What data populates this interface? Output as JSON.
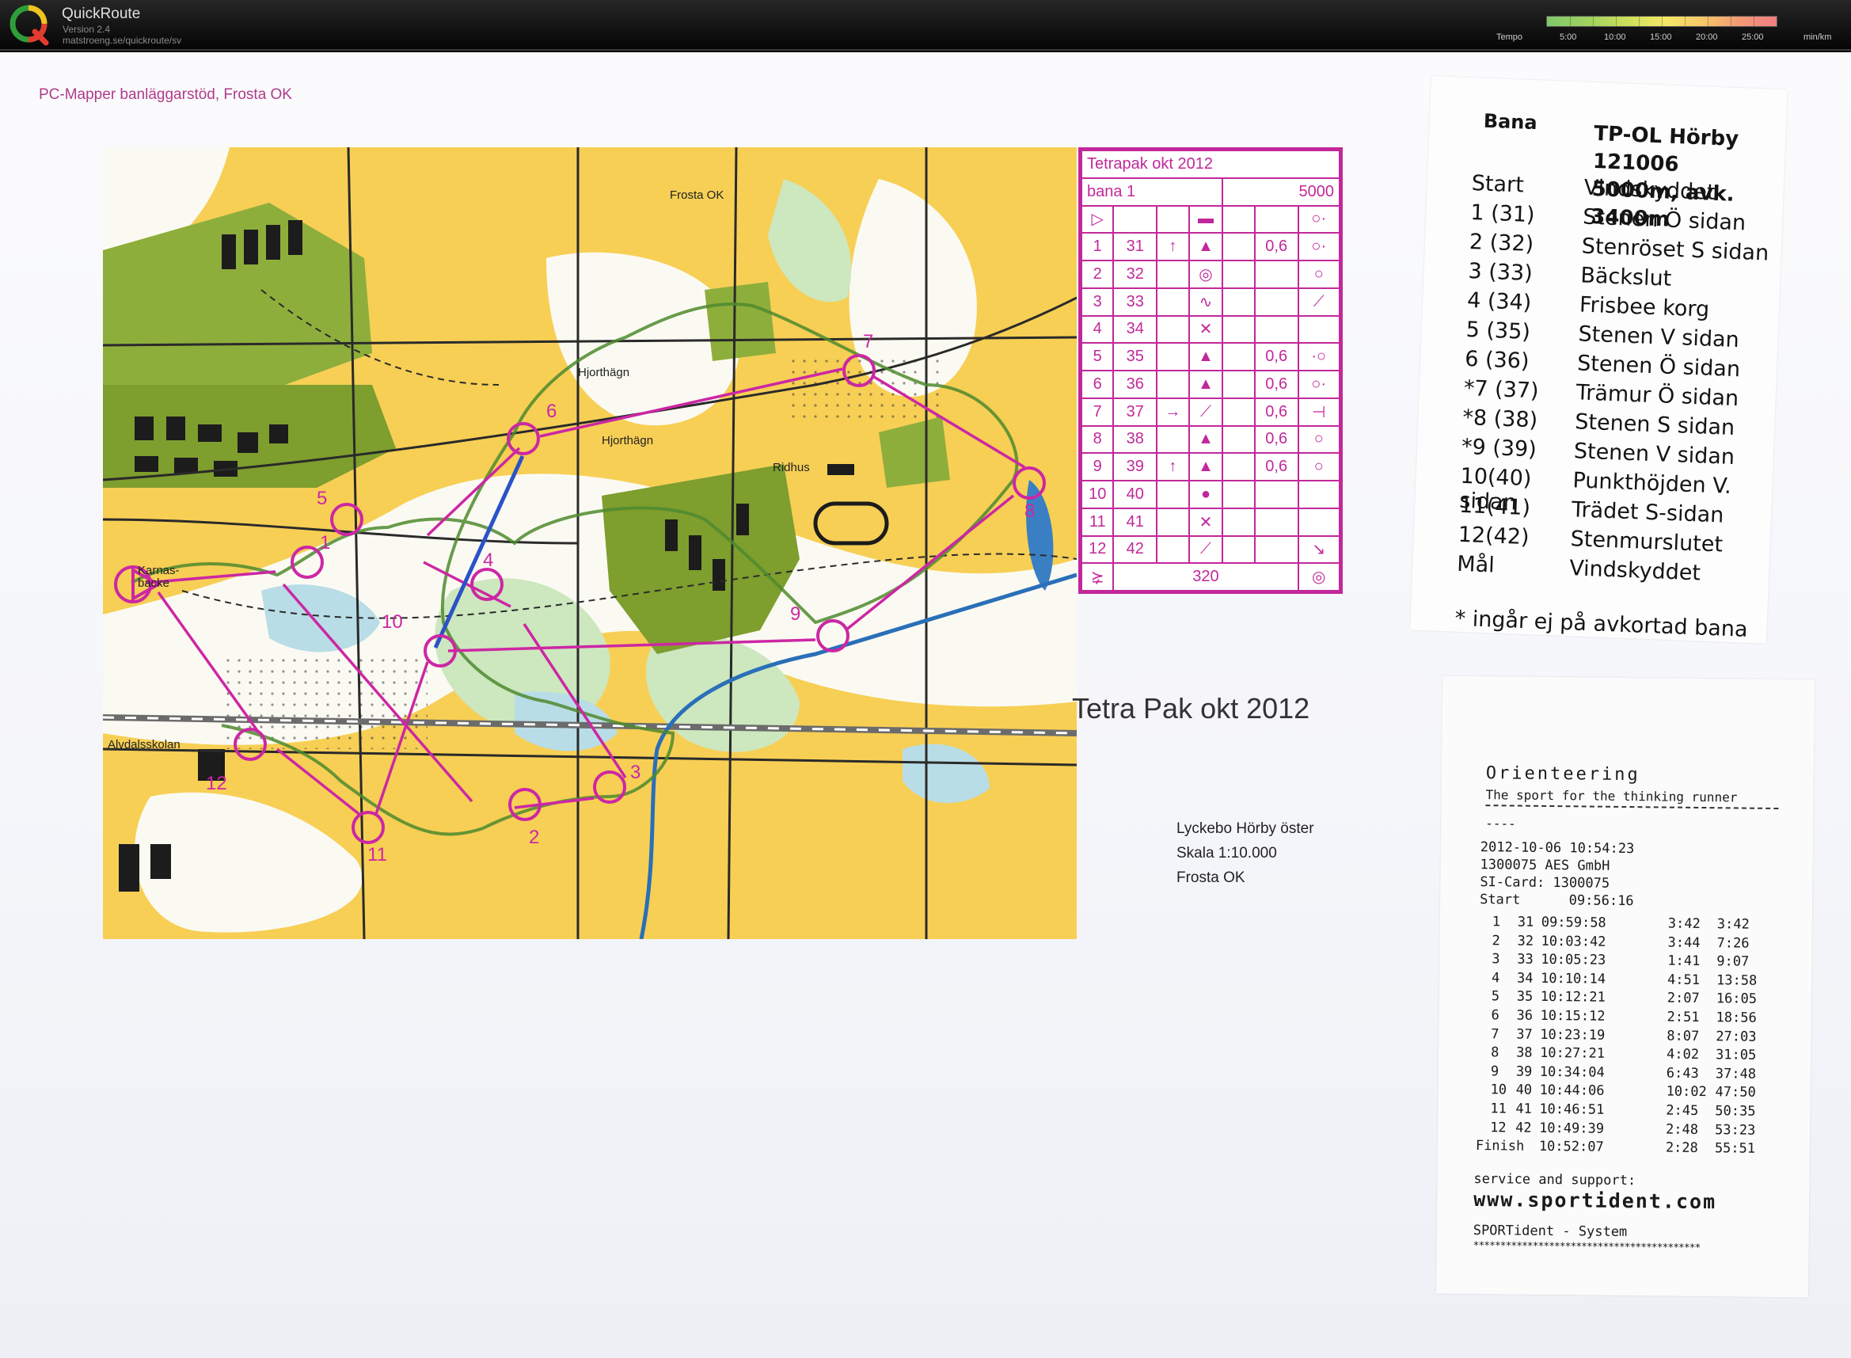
{
  "app": {
    "name": "QuickRoute",
    "version": "Version 2.4",
    "url": "matstroeng.se/quickroute/sv"
  },
  "tempo_legend": {
    "label": "Tempo",
    "ticks": [
      "5:00",
      "10:00",
      "15:00",
      "20:00",
      "25:00"
    ],
    "unit": "min/km"
  },
  "map": {
    "heading": "PC-Mapper banläggarstöd, Frosta OK",
    "caption": "Tetra Pak okt 2012",
    "place": "Lyckebo Hörby öster",
    "scale": "Skala 1:10.000",
    "club": "Frosta OK",
    "place_names": [
      "Frosta OK",
      "Hjorthägn",
      "Hjorthägn",
      "Ridhus",
      "Karnas-",
      "backe",
      "Alvdalsskolan"
    ],
    "control_numbers": [
      "1",
      "2",
      "3",
      "4",
      "5",
      "6",
      "7",
      "8",
      "9",
      "10",
      "11",
      "12"
    ]
  },
  "control_description": {
    "event": "Tetrapak okt 2012",
    "course": "bana 1",
    "length": "5000",
    "rows": [
      {
        "seq": "1",
        "code": "31",
        "dir": "↑",
        "feature": "▲",
        "dim": "0,6",
        "loc": "○·"
      },
      {
        "seq": "2",
        "code": "32",
        "dir": "",
        "feature": "◎",
        "dim": "",
        "loc": "○"
      },
      {
        "seq": "3",
        "code": "33",
        "dir": "",
        "feature": "∿",
        "dim": "",
        "loc": "⟋"
      },
      {
        "seq": "4",
        "code": "34",
        "dir": "",
        "feature": "✕",
        "dim": "",
        "loc": ""
      },
      {
        "seq": "5",
        "code": "35",
        "dir": "",
        "feature": "▲",
        "dim": "0,6",
        "loc": "·○"
      },
      {
        "seq": "6",
        "code": "36",
        "dir": "",
        "feature": "▲",
        "dim": "0,6",
        "loc": "○·"
      },
      {
        "seq": "7",
        "code": "37",
        "dir": "→",
        "feature": "⟋",
        "dim": "0,6",
        "loc": "⊣"
      },
      {
        "seq": "8",
        "code": "38",
        "dir": "",
        "feature": "▲",
        "dim": "0,6",
        "loc": "○"
      },
      {
        "seq": "9",
        "code": "39",
        "dir": "↑",
        "feature": "▲",
        "dim": "0,6",
        "loc": "○"
      },
      {
        "seq": "10",
        "code": "40",
        "dir": "",
        "feature": "●",
        "dim": "",
        "loc": ""
      },
      {
        "seq": "11",
        "code": "41",
        "dir": "",
        "feature": "✕",
        "dim": "",
        "loc": ""
      },
      {
        "seq": "12",
        "code": "42",
        "dir": "",
        "feature": "⟋",
        "dim": "",
        "loc": "↘"
      }
    ],
    "finish_distance": "320"
  },
  "course_note": {
    "heading": "Bana",
    "title_line1": "TP-OL Hörby 121006",
    "title_line2": "5000m, avk. 3400m",
    "rows": [
      {
        "n": "Start",
        "d": "Vindskyddet"
      },
      {
        "n": "1 (31)",
        "d": "Stenen Ö sidan"
      },
      {
        "n": "2 (32)",
        "d": "Stenröset S sidan"
      },
      {
        "n": "3 (33)",
        "d": "Bäckslut"
      },
      {
        "n": "4 (34)",
        "d": "Frisbee korg"
      },
      {
        "n": "5 (35)",
        "d": "Stenen V sidan"
      },
      {
        "n": "6 (36)",
        "d": "Stenen Ö sidan"
      },
      {
        "n": "*7 (37)",
        "d": "Trämur Ö sidan"
      },
      {
        "n": "*8 (38)",
        "d": "Stenen S sidan"
      },
      {
        "n": "*9 (39)",
        "d": "Stenen V sidan"
      },
      {
        "n": "10(40)",
        "d": "Punkthöjden V. sidan"
      },
      {
        "n": "11(41)",
        "d": "Trädet S-sidan"
      },
      {
        "n": "12(42)",
        "d": "Stenmurslutet"
      },
      {
        "n": "Mål",
        "d": "Vindskyddet"
      }
    ],
    "footnote": "* ingår ej på avkortad bana"
  },
  "receipt": {
    "brand": "Orienteering",
    "tagline": "The sport for the thinking runner",
    "dashes": "----",
    "date_time": "2012-10-06  10:54:23",
    "card_owner": "1300075 AES GmbH",
    "si_card": "SI-Card:  1300075",
    "start": "Start      09:56:16",
    "splits": [
      {
        "n": "1",
        "code": "31",
        "time": "09:59:58",
        "leg": "3:42",
        "total": "3:42"
      },
      {
        "n": "2",
        "code": "32",
        "time": "10:03:42",
        "leg": "3:44",
        "total": "7:26"
      },
      {
        "n": "3",
        "code": "33",
        "time": "10:05:23",
        "leg": "1:41",
        "total": "9:07"
      },
      {
        "n": "4",
        "code": "34",
        "time": "10:10:14",
        "leg": "4:51",
        "total": "13:58"
      },
      {
        "n": "5",
        "code": "35",
        "time": "10:12:21",
        "leg": "2:07",
        "total": "16:05"
      },
      {
        "n": "6",
        "code": "36",
        "time": "10:15:12",
        "leg": "2:51",
        "total": "18:56"
      },
      {
        "n": "7",
        "code": "37",
        "time": "10:23:19",
        "leg": "8:07",
        "total": "27:03"
      },
      {
        "n": "8",
        "code": "38",
        "time": "10:27:21",
        "leg": "4:02",
        "total": "31:05"
      },
      {
        "n": "9",
        "code": "39",
        "time": "10:34:04",
        "leg": "6:43",
        "total": "37:48"
      },
      {
        "n": "10",
        "code": "40",
        "time": "10:44:06",
        "leg": "10:02",
        "total": "47:50"
      },
      {
        "n": "11",
        "code": "41",
        "time": "10:46:51",
        "leg": "2:45",
        "total": "50:35"
      },
      {
        "n": "12",
        "code": "42",
        "time": "10:49:39",
        "leg": "2:48",
        "total": "53:23"
      },
      {
        "n": "Finish",
        "code": "",
        "time": "10:52:07",
        "leg": "2:28",
        "total": "55:51"
      }
    ],
    "service": "service and support:",
    "url": "www.sportident.com",
    "system": "SPORTident - System",
    "stars": "******************************************"
  }
}
